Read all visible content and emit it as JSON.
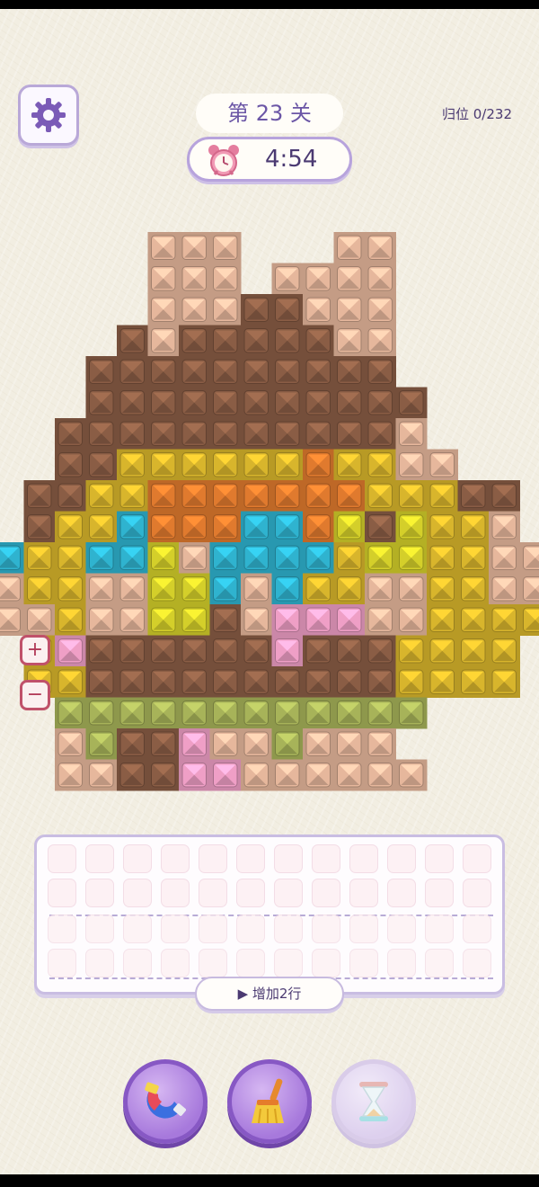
{
  "header": {
    "level_text": "第 23 关",
    "timer": "4:54",
    "progress": "归位 0/232"
  },
  "icons": {
    "settings": "gear-icon",
    "timer": "alarm-clock-icon",
    "zoom_in": "plus-icon",
    "zoom_out": "minus-icon",
    "power_magnet": "magnet-icon",
    "power_broom": "broom-icon",
    "power_hourglass": "hourglass-icon"
  },
  "zoom": {
    "plus": "+",
    "minus": "−"
  },
  "slots": {
    "rows_active": 2,
    "rows_locked": 2,
    "cols": 12
  },
  "add_row_label": "▶ 增加2行",
  "colors": {
    "brown": "#8a5d45",
    "tan": "#e6b79c",
    "yellow": "#d8b52c",
    "orange": "#e07a2e",
    "cyan": "#2fb3cf",
    "pink": "#ef9fc6",
    "olive": "#a7b359",
    "lime": "#d4cf2a",
    "accent": "#7b5bb7"
  },
  "board": {
    "palette": {
      "N": "#8a5d45",
      "T": "#e6b79c",
      "Y": "#d8b52c",
      "O": "#e07a2e",
      "C": "#2fb3cf",
      "P": "#ef9fc6",
      "G": "#a7b359",
      "L": "#d4cf2a"
    },
    "rows": [
      "     TTT   TT     ",
      "     TTT TTTT     ",
      "     TTTNNTTT     ",
      "    NTNNNNNTT     ",
      "   NNNNNNNNNN     ",
      "   NNNNNNNNNNN    ",
      "  NNNNNNNNNNNT    ",
      "  NNYYYYYYOYYTT   ",
      " NNYYOOOOOOOYYYNN ",
      " NYYCOOOCCOLNLYYT ",
      "CYYCCLTCCCCYLLYYTT",
      "TYYTTLLCTCYYTTYYTT",
      "TTYTTLLNTPPPTTYYYY",
      " YPNNNNNNPNNNYYYY ",
      " YYNNNNNNNNNNYYYY ",
      "  GGGGGGGGGGGG    ",
      "  TGNNPTTGTTT     ",
      "  TTNNPPTTTTTT    "
    ]
  }
}
